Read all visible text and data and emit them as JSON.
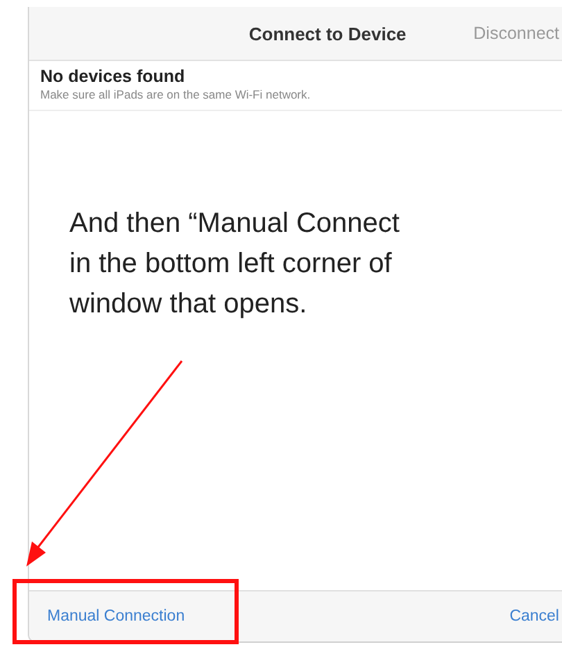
{
  "dialog": {
    "title": "Connect to Device",
    "header_action": {
      "label": "Disconnect",
      "disabled": true
    },
    "message": {
      "heading": "No devices found",
      "detail": "Make sure all iPads are on the same Wi-Fi network."
    },
    "footer": {
      "left_button": "Manual Connection",
      "right_button": "Cancel"
    }
  },
  "annotation": {
    "lines": [
      "And then “Manual Connect",
      "in the bottom left corner of",
      "window that opens."
    ]
  }
}
